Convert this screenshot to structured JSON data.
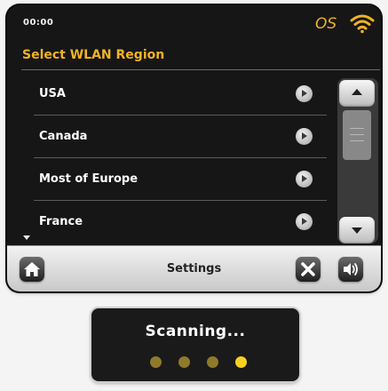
{
  "status": {
    "time": "00:00",
    "logo_icon": "os-logo-icon",
    "wifi_icon": "wifi-icon"
  },
  "header": {
    "title": "Select WLAN Region"
  },
  "list": {
    "items": [
      {
        "label": "USA"
      },
      {
        "label": "Canada"
      },
      {
        "label": "Most of Europe"
      },
      {
        "label": "France"
      }
    ]
  },
  "bottom": {
    "title": "Settings",
    "home_icon": "home-icon",
    "close_icon": "close-icon",
    "volume_icon": "volume-icon"
  },
  "popup": {
    "text": "Scanning...",
    "dots_total": 4,
    "dots_active_index": 3
  },
  "colors": {
    "accent": "#f0b323",
    "dot_inactive": "#8f7a2b",
    "dot_active": "#f7d11f"
  }
}
